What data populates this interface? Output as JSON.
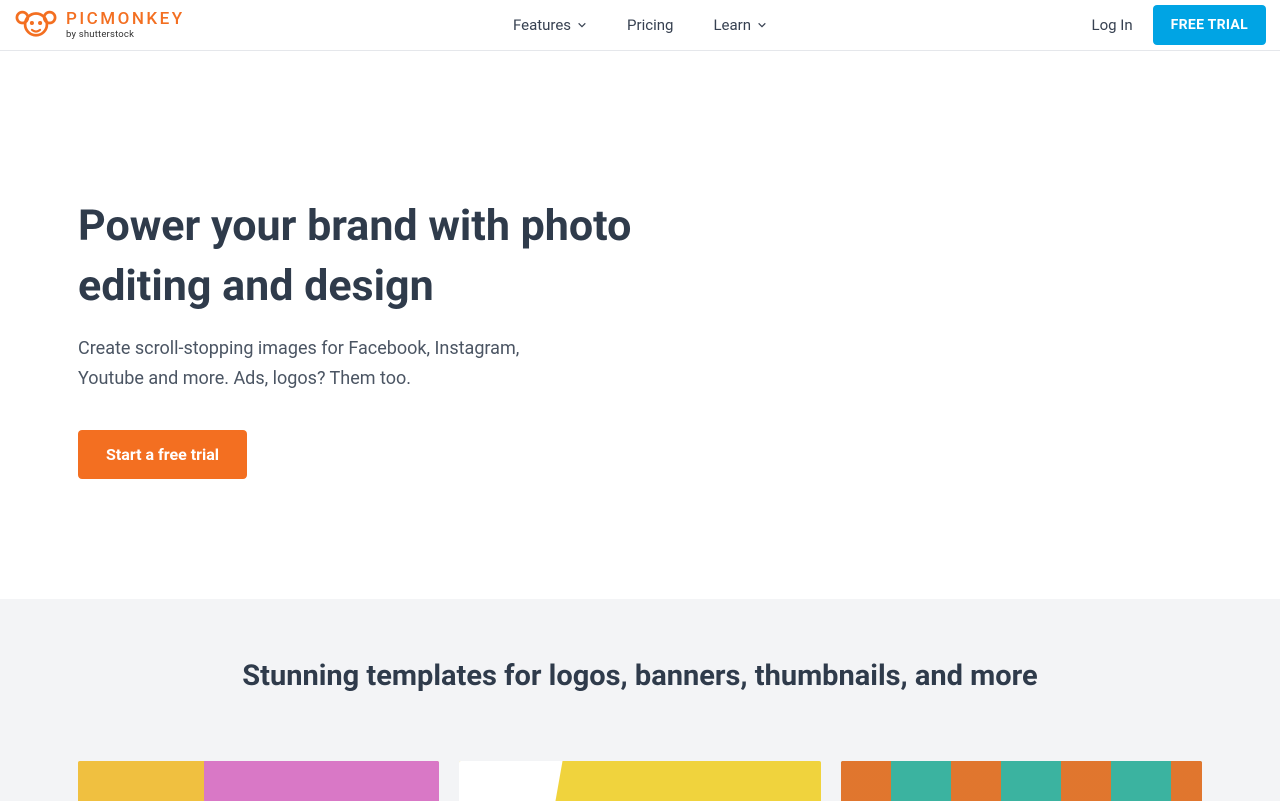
{
  "header": {
    "logo_main": "PICMONKEY",
    "logo_sub": "by shutterstock",
    "nav": {
      "features": "Features",
      "pricing": "Pricing",
      "learn": "Learn"
    },
    "login": "Log In",
    "free_trial": "FREE TRIAL"
  },
  "hero": {
    "headline": "Power your brand with photo editing and design",
    "sub": "Create scroll-stopping images for Facebook, Instagram, Youtube and more. Ads, logos? Them too.",
    "cta": "Start a free trial"
  },
  "templates": {
    "heading": "Stunning templates for logos, banners, thumbnails, and more"
  },
  "colors": {
    "brand_orange": "#f36f21",
    "brand_blue": "#00a4e4"
  }
}
